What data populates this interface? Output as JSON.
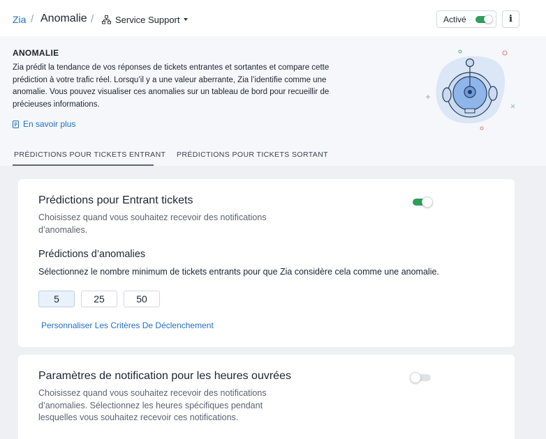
{
  "breadcrumb": {
    "root": "Zia",
    "separator": "/",
    "title": "Anomalie",
    "department": "Service Support"
  },
  "header": {
    "status_label": "Activé",
    "status_enabled": true,
    "info_label": "i"
  },
  "info": {
    "heading": "ANOMALIE",
    "description": "Zia prédit la tendance de vos réponses de tickets entrantes et sortantes et compare cette prédiction à votre trafic réel. Lorsqu’il y a une valeur aberrante, Zia l’identifie comme une anomalie. Vous pouvez visualiser ces anomalies sur un tableau de bord pour recueillir de précieuses informations.",
    "learn_more": "En savoir plus"
  },
  "tabs": [
    {
      "label": "PRÉDICTIONS POUR TICKETS ENTRANT",
      "active": true
    },
    {
      "label": "PRÉDICTIONS POUR TICKETS SORTANT",
      "active": false
    }
  ],
  "incoming_card": {
    "title": "Prédictions pour Entrant tickets",
    "description": "Choisissez quand vous souhaitez recevoir des notifications d’anomalies.",
    "enabled": true,
    "predictions_title": "Prédictions d’anomalies",
    "predictions_description": "Sélectionnez le nombre minimum de tickets entrants pour que Zia considère cela comme une anomalie.",
    "threshold_options": [
      "5",
      "25",
      "50"
    ],
    "selected_option": "5",
    "custom_link": "Personnaliser Les Critères De Déclenchement"
  },
  "business_hours_card": {
    "title": "Paramètres de notification pour les heures ouvrées",
    "description": "Choisissez quand vous souhaitez recevoir des notifications d’anomalies. Sélectionnez les heures spécifiques pendant lesquelles vous souhaitez recevoir ces notifications.",
    "enabled": false
  },
  "colors": {
    "accent": "#1f6fbf",
    "toggle_on": "#2e9e58",
    "page_bg": "#eef0f4"
  }
}
